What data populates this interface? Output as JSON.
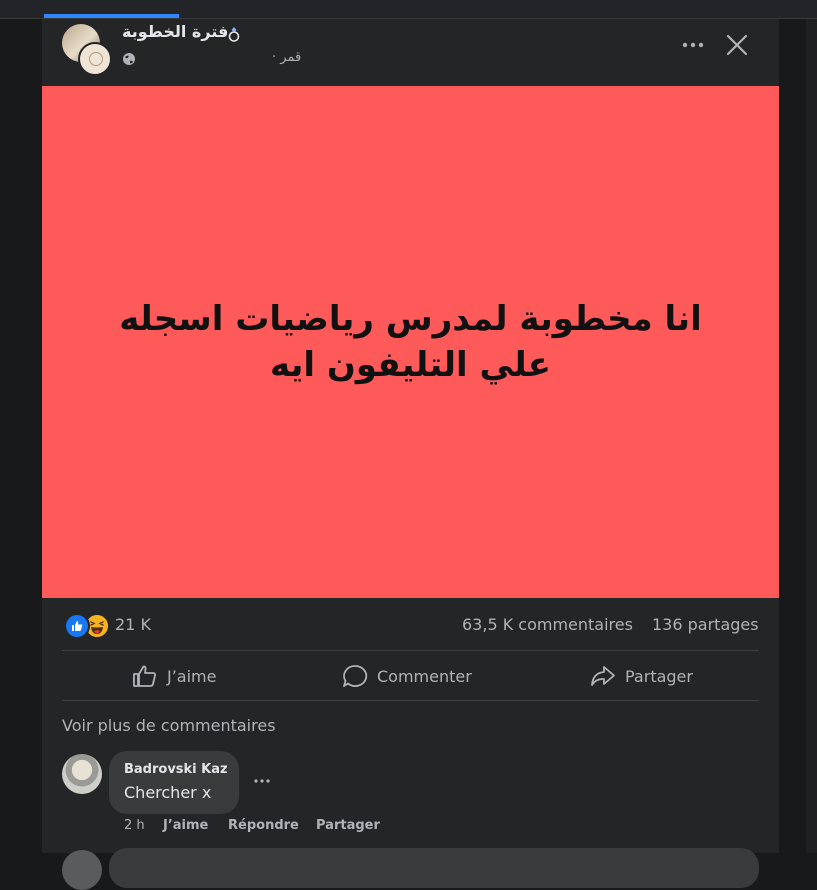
{
  "post": {
    "page_name": "فترة الخطوبة",
    "date": "قمر ·",
    "image_text": "انا مخطوبة لمدرس رياضيات اسجله علي التليفون ايه",
    "colors": {
      "image_bg": "#fe5a5a",
      "like": "#1877f2",
      "haha": "#f7b125"
    }
  },
  "stats": {
    "reactions": "21 K",
    "comments": "63,5 K commentaires",
    "shares": "136 partages"
  },
  "actions": {
    "like": "J’aime",
    "comment": "Commenter",
    "share": "Partager"
  },
  "comments": {
    "more_label": "Voir plus de commentaires",
    "items": [
      {
        "author": "Badrovski Kaz",
        "text": "Chercher x",
        "time": "2 h",
        "like": "J’aime",
        "reply": "Répondre",
        "share": "Partager"
      }
    ]
  }
}
